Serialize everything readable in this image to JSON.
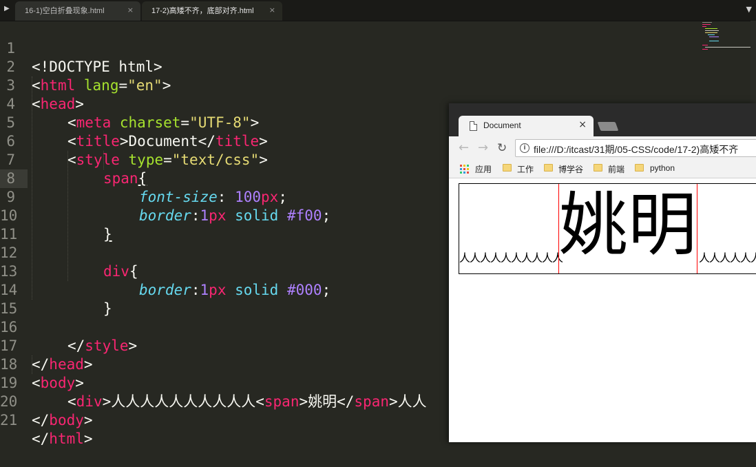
{
  "tabs": [
    {
      "label": "16-1)空白折叠现象.html",
      "close": "×"
    },
    {
      "label": "17-2)高矮不齐，底部对齐.html",
      "close": "×"
    }
  ],
  "tab_arrow": "▶",
  "tab_dropdown": "▼",
  "line_numbers": [
    "1",
    "2",
    "3",
    "4",
    "5",
    "6",
    "7",
    "8",
    "9",
    "10",
    "11",
    "12",
    "13",
    "14",
    "15",
    "16",
    "17",
    "18",
    "19",
    "20",
    "21"
  ],
  "code": {
    "l1": {
      "a": "<!DOCTYPE html>"
    },
    "l2": {
      "a": "<",
      "b": "html",
      "c": " ",
      "d": "lang",
      "e": "=",
      "f": "\"en\"",
      "g": ">"
    },
    "l3": {
      "a": "<",
      "b": "head",
      "c": ">"
    },
    "l4": {
      "a": "<",
      "b": "meta",
      "c": " ",
      "d": "charset",
      "e": "=",
      "f": "\"UTF-8\"",
      "g": ">"
    },
    "l5": {
      "a": "<",
      "b": "title",
      "c": ">Document</",
      "d": "title",
      "e": ">"
    },
    "l6": {
      "a": "<",
      "b": "style",
      "c": " ",
      "d": "type",
      "e": "=",
      "f": "\"text/css\"",
      "g": ">"
    },
    "l7": {
      "a": "span",
      "b": "{"
    },
    "l8": {
      "a": "font-size",
      "b": ": ",
      "c": "100",
      "d": "px",
      "e": ";"
    },
    "l9": {
      "a": "border",
      "b": ":",
      "c": "1",
      "d": "px",
      "e": " solid ",
      "f": "#f00",
      "g": ";"
    },
    "l10": {
      "a": "}"
    },
    "l12": {
      "a": "div",
      "b": "{"
    },
    "l13": {
      "a": "border",
      "b": ":",
      "c": "1",
      "d": "px",
      "e": " solid ",
      "f": "#000",
      "g": ";"
    },
    "l14": {
      "a": "}"
    },
    "l16": {
      "a": "</",
      "b": "style",
      "c": ">"
    },
    "l17": {
      "a": "</",
      "b": "head",
      "c": ">"
    },
    "l18": {
      "a": "<",
      "b": "body",
      "c": ">"
    },
    "l19": {
      "a": "<",
      "b": "div",
      "c": ">人人人人人人人人人人<",
      "d": "span",
      "e": ">姚明</",
      "f": "span",
      "g": ">人人"
    },
    "l20": {
      "a": "</",
      "b": "body",
      "c": ">"
    },
    "l21": {
      "a": "</",
      "b": "html",
      "c": ">"
    }
  },
  "browser": {
    "tab_title": "Document",
    "tab_close": "×",
    "back": "←",
    "forward": "→",
    "reload": "↻",
    "info": "i",
    "url": "file:///D:/itcast/31期/05-CSS/code/17-2)高矮不齐",
    "bookmarks": [
      "应用",
      "工作",
      "博学谷",
      "前端",
      "python"
    ],
    "page_text_left": "人人人人人人人人人人",
    "page_span": "姚明",
    "page_text_right": "人人人人人人"
  },
  "colors": {
    "editor_bg": "#272822",
    "tag": "#f92672",
    "attr": "#a6e22e",
    "string": "#e6db74",
    "property": "#66d9ef",
    "number": "#ae81ff",
    "span_border": "#ff0000",
    "div_border": "#000000"
  }
}
